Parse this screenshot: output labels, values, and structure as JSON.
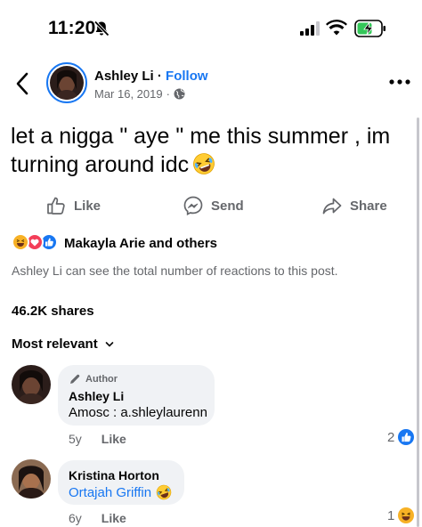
{
  "status_bar": {
    "time": "11:20",
    "icons": [
      "bell-slash-icon",
      "signal-icon",
      "wifi-icon",
      "battery-charging-icon"
    ]
  },
  "post": {
    "author": "Ashley Li",
    "separator": "·",
    "follow_label": "Follow",
    "date": "Mar 16, 2019",
    "date_separator": "·",
    "text": "let a nigga \" aye \" me this summer , im turning around idc",
    "text_emoji": "rolling-laughing-emoji"
  },
  "actions": {
    "like_label": "Like",
    "send_label": "Send",
    "share_label": "Share"
  },
  "reactions": {
    "icons": [
      "haha-reaction",
      "love-reaction",
      "like-reaction"
    ],
    "summary": "Makayla Arie and others",
    "note": "Ashley Li can see the total number of reactions to this post."
  },
  "shares": "46.2K shares",
  "sort_label": "Most relevant",
  "comments": [
    {
      "badge": "Author",
      "name": "Ashley Li",
      "text": "Amosc : a.shleylaurenn",
      "time": "5y",
      "like_label": "Like",
      "reaction_count": "2",
      "reaction_icon": "like-reaction"
    },
    {
      "name": "Kristina Horton",
      "tag": "Ortajah Griffin",
      "tag_emoji": "rolling-laughing-emoji",
      "time": "6y",
      "like_label": "Like",
      "reaction_count": "1",
      "reaction_icon": "haha-reaction"
    }
  ],
  "colors": {
    "accent": "#1877f2",
    "secondary_text": "#65676b",
    "bubble": "#f0f2f5",
    "love": "#f33e58",
    "haha": "#f7b125"
  }
}
